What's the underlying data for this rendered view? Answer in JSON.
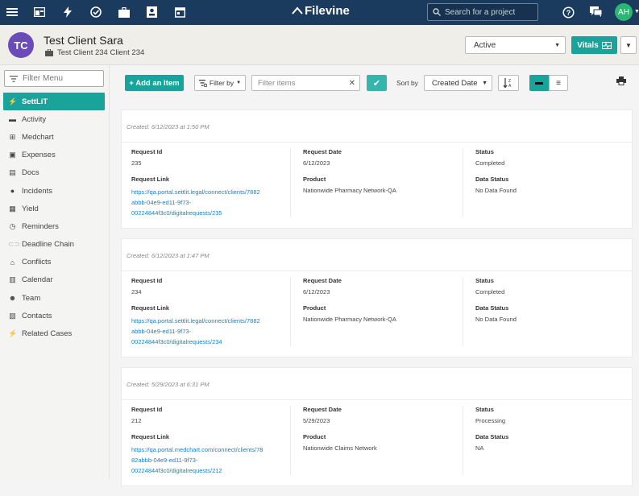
{
  "topbar": {
    "logo_text": "Filevine",
    "search_placeholder": "Search for a project",
    "user_initials": "AH"
  },
  "header": {
    "client_initials": "TC",
    "client_name": "Test Client Sara",
    "client_sub": "Test Client 234 Client 234",
    "status_value": "Active",
    "vitals_label": "Vitals"
  },
  "sidebar": {
    "filter_placeholder": "Filter Menu",
    "items": [
      {
        "label": "SettLiT",
        "icon": "bolt-icon"
      },
      {
        "label": "Activity",
        "icon": "chat-icon"
      },
      {
        "label": "Medchart",
        "icon": "medkit-icon"
      },
      {
        "label": "Expenses",
        "icon": "money-icon"
      },
      {
        "label": "Docs",
        "icon": "document-icon"
      },
      {
        "label": "Incidents",
        "icon": "bomb-icon"
      },
      {
        "label": "Yield",
        "icon": "table-icon"
      },
      {
        "label": "Reminders",
        "icon": "clock-icon"
      },
      {
        "label": "Deadline Chain",
        "icon": "chain-icon"
      },
      {
        "label": "Conflicts",
        "icon": "bank-icon"
      },
      {
        "label": "Calendar",
        "icon": "calendar-icon"
      },
      {
        "label": "Team",
        "icon": "team-icon"
      },
      {
        "label": "Contacts",
        "icon": "contacts-icon"
      },
      {
        "label": "Related Cases",
        "icon": "bolt-icon"
      }
    ]
  },
  "toolbar": {
    "add_label": "+ Add an Item",
    "filterby_label": "Filter by",
    "filter_items_placeholder": "Filter items",
    "sortby_label": "Sort by",
    "sort_value": "Created Date"
  },
  "labels": {
    "request_id": "Request Id",
    "request_link": "Request Link",
    "request_date": "Request Date",
    "product": "Product",
    "status": "Status",
    "data_status": "Data Status"
  },
  "cards": [
    {
      "created": "Created: 6/12/2023 at 1:50 PM",
      "request_id": "235",
      "request_link": "https://qa.portal.settlit.legal/connect/clients/7882abbb-04e9-ed11-9f73-00224844f3c0/digitalrequests/235",
      "link_lines": [
        "https://qa.portal.settlit.legal/connect/clients/7882",
        "abbb-04e9-ed11-9f73-",
        "00224844f3c0/digitalrequests/235"
      ],
      "request_date": "6/12/2023",
      "product": "Nationwide Pharmacy Network-QA",
      "status": "Completed",
      "data_status": "No Data Found"
    },
    {
      "created": "Created: 6/12/2023 at 1:47 PM",
      "request_id": "234",
      "request_link": "https://qa.portal.settlit.legal/connect/clients/7882abbb-04e9-ed11-9f73-00224844f3c0/digitalrequests/234",
      "link_lines": [
        "https://qa.portal.settlit.legal/connect/clients/7882",
        "abbb-04e9-ed11-9f73-",
        "00224844f3c0/digitalrequests/234"
      ],
      "request_date": "6/12/2023",
      "product": "Nationwide Pharmacy Network-QA",
      "status": "Completed",
      "data_status": "No Data Found"
    },
    {
      "created": "Created: 5/29/2023 at 6:31 PM",
      "request_id": "212",
      "request_link": "https://qa.portal.medchart.com/connect/clients/7882abbb-04e9-ed11-9f73-00224844f3c0/digitalrequests/212",
      "link_lines": [
        "https://qa.portal.medchart.com/connect/clients/78",
        "82abbb-04e9-ed11-9f73-",
        "00224844f3c0/digitalrequests/212"
      ],
      "request_date": "5/29/2023",
      "product": "Nationwide Claims Network",
      "status": "Processing",
      "data_status": "NA"
    }
  ]
}
